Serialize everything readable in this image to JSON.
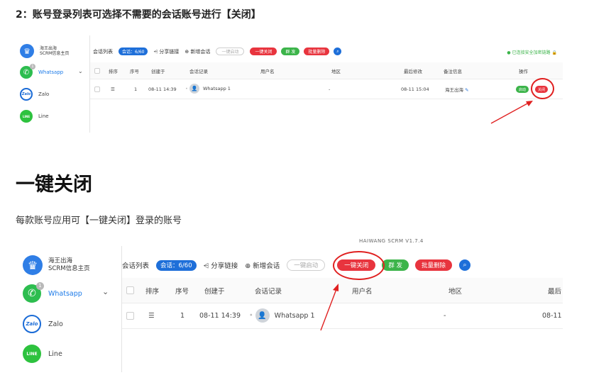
{
  "doc": {
    "step_title": "2：账号登录列表可选择不需要的会话账号进行【关闭】",
    "section_heading": "一键关闭",
    "description": "每款账号应用可【一键关闭】登录的账号",
    "version_label": "HAIWANG SCRM V1.7.4"
  },
  "sidebar": {
    "brand_line1": "海王出海",
    "brand_line2": "SCRM信息主页",
    "apps": [
      {
        "label": "Whatsapp",
        "icon": "whatsapp-icon",
        "badge": "1"
      },
      {
        "label": "Zalo",
        "icon": "zalo-icon",
        "glyph": "Zalo"
      },
      {
        "label": "Line",
        "icon": "line-icon",
        "glyph": "LINE"
      }
    ]
  },
  "toolbar": {
    "session_list": "会话列表",
    "session_count": "会话：6/60",
    "share_link": "分享链接",
    "new_session": "新增会话",
    "one_click_start": "一键启动",
    "one_click_close": "一键关闭",
    "group_send": "群 发",
    "batch_delete": "批量删除",
    "status_text": "已连接安全加密链路"
  },
  "table": {
    "headers": [
      "排序",
      "序号",
      "创建于",
      "会话记录",
      "用户名",
      "地区",
      "最后修改",
      "备注信息",
      "操作"
    ],
    "headers_bottom": [
      "排序",
      "序号",
      "创建于",
      "会话记录",
      "用户名",
      "地区",
      "最后"
    ],
    "row_top": {
      "index": "1",
      "created": "08-11 14:39",
      "session": "Whatsapp 1",
      "region": "-",
      "modified": "08-11 15:04",
      "remark": "海王出海",
      "btn_launch": "启动",
      "btn_close": "关闭"
    },
    "row_bottom": {
      "index": "1",
      "created": "08-11 14:39",
      "session": "Whatsapp 1",
      "region": "-",
      "modified": "08-11"
    }
  },
  "colors": {
    "accent_blue": "#1e6fd9",
    "danger_red": "#e8343e",
    "success_green": "#3cb44a",
    "annotation_red": "#e02020"
  }
}
